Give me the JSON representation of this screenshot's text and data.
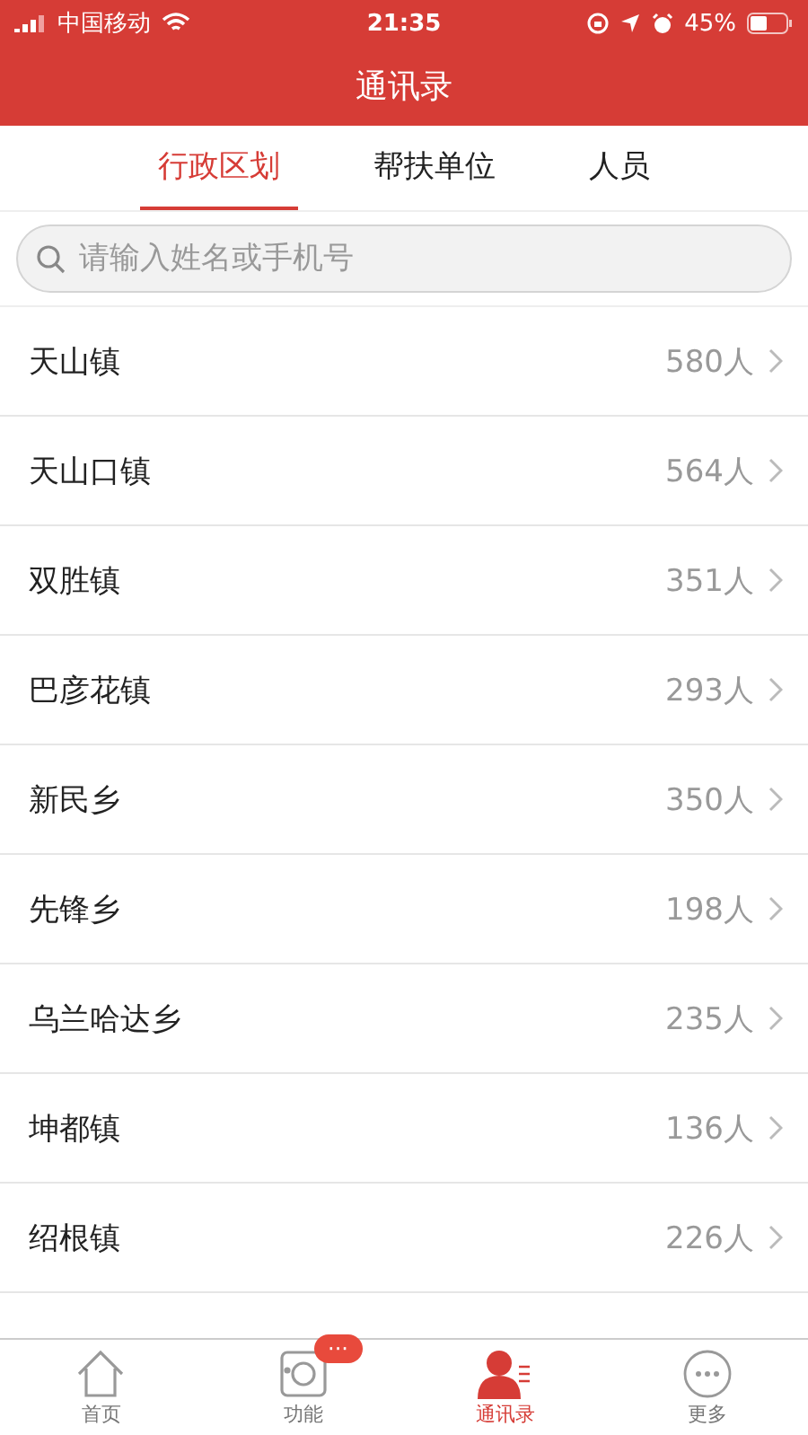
{
  "status_bar": {
    "carrier": "中国移动",
    "time": "21:35",
    "battery": "45%"
  },
  "title": "通讯录",
  "tabs": [
    {
      "label": "行政区划",
      "selected": true
    },
    {
      "label": "帮扶单位",
      "selected": false
    },
    {
      "label": "人员",
      "selected": false
    }
  ],
  "search": {
    "placeholder": "请输入姓名或手机号"
  },
  "rows": [
    {
      "name": "天山镇",
      "count": "580人"
    },
    {
      "name": "天山口镇",
      "count": "564人"
    },
    {
      "name": "双胜镇",
      "count": "351人"
    },
    {
      "name": "巴彦花镇",
      "count": "293人"
    },
    {
      "name": "新民乡",
      "count": "350人"
    },
    {
      "name": "先锋乡",
      "count": "198人"
    },
    {
      "name": "乌兰哈达乡",
      "count": "235人"
    },
    {
      "name": "坤都镇",
      "count": "136人"
    },
    {
      "name": "绍根镇",
      "count": "226人"
    }
  ],
  "nav": [
    {
      "kind": "home",
      "label": "首页",
      "selected": false
    },
    {
      "kind": "function",
      "label": "功能",
      "selected": false,
      "badge": "···"
    },
    {
      "kind": "contacts",
      "label": "通讯录",
      "selected": true
    },
    {
      "kind": "more",
      "label": "更多",
      "selected": false
    }
  ]
}
